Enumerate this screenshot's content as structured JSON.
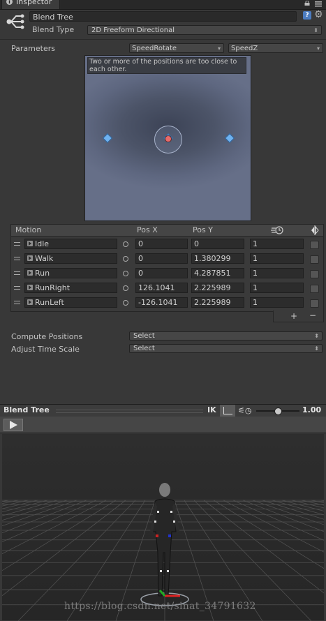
{
  "tab": {
    "title": "Inspector"
  },
  "header": {
    "name": "Blend Tree",
    "blend_type_label": "Blend Type",
    "blend_type_value": "2D Freeform Directional"
  },
  "parameters": {
    "label": "Parameters",
    "param_x": "SpeedRotate",
    "param_y": "SpeedZ"
  },
  "graph": {
    "warning": "Two or more of the positions are too close to each other."
  },
  "motion_table": {
    "headers": {
      "motion": "Motion",
      "pos_x": "Pos X",
      "pos_y": "Pos Y"
    },
    "rows": [
      {
        "name": "Idle",
        "pos_x": "0",
        "pos_y": "0",
        "speed": "1"
      },
      {
        "name": "Walk",
        "pos_x": "0",
        "pos_y": "1.380299",
        "speed": "1"
      },
      {
        "name": "Run",
        "pos_x": "0",
        "pos_y": "4.287851",
        "speed": "1"
      },
      {
        "name": "RunRight",
        "pos_x": "126.1041",
        "pos_y": "2.225989",
        "speed": "1"
      },
      {
        "name": "RunLeft",
        "pos_x": "-126.1041",
        "pos_y": "2.225989",
        "speed": "1"
      }
    ],
    "add_label": "+",
    "remove_label": "−"
  },
  "options": {
    "compute_positions_label": "Compute Positions",
    "compute_positions_value": "Select",
    "adjust_time_scale_label": "Adjust Time Scale",
    "adjust_time_scale_value": "Select"
  },
  "preview": {
    "title": "Blend Tree",
    "ik_label": "IK",
    "speed_value": "1.00",
    "playback_speed": 0.5
  },
  "watermark": "https://blog.csdn.net/sinat_34791632",
  "colors": {
    "graph_bg": "#5e6780",
    "diamond": "#6fb2f0",
    "active_sample": "#e66a6a",
    "help_icon": "#4b7bbf"
  }
}
